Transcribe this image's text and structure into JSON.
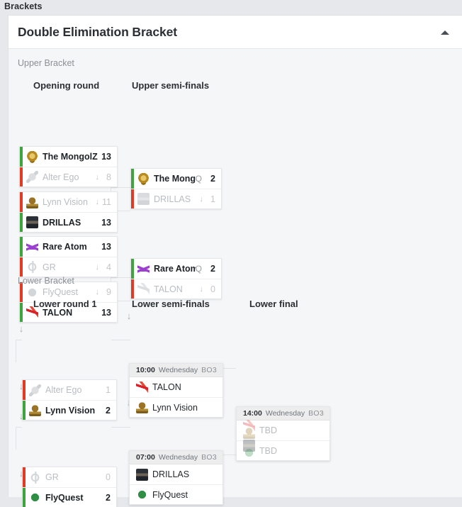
{
  "page": {
    "title": "Brackets"
  },
  "panel": {
    "heading": "Double Elimination Bracket",
    "collapse_icon": "chevron-up-icon"
  },
  "sections": {
    "upper": {
      "label": "Upper Bracket"
    },
    "lower": {
      "label": "Lower Bracket"
    }
  },
  "rounds": {
    "opening": "Opening round",
    "upper_semis": "Upper semi-finals",
    "lower_r1": "Lower round 1",
    "lower_semis": "Lower semi-finals",
    "lower_final": "Lower final"
  },
  "colors": {
    "winner_bar": "#3fa43f",
    "loser_bar": "#e03b24",
    "page_bg": "#e6e8eb",
    "body_bg": "#f5f6f7",
    "card_bg": "#ffffff"
  },
  "labels": {
    "down_arrow": "↓",
    "qualified": "Q",
    "tbd": "TBD",
    "drop_marker": "↓"
  },
  "upper_bracket": {
    "opening_round": [
      {
        "teams": [
          {
            "name": "The MongolZ",
            "score": "13",
            "result": "win",
            "logo": "mongolz-logo"
          },
          {
            "name": "Alter Ego",
            "score": "8",
            "result": "lose",
            "logo": "alter-ego-logo"
          }
        ]
      },
      {
        "teams": [
          {
            "name": "Lynn Vision",
            "score": "11",
            "result": "lose",
            "logo": "lynn-vision-logo"
          },
          {
            "name": "DRILLAS",
            "score": "13",
            "result": "win",
            "logo": "drillas-logo"
          }
        ]
      },
      {
        "teams": [
          {
            "name": "Rare Atom",
            "score": "13",
            "result": "win",
            "logo": "rare-atom-logo"
          },
          {
            "name": "GR",
            "score": "4",
            "result": "lose",
            "logo": "gr-logo"
          }
        ]
      },
      {
        "teams": [
          {
            "name": "FlyQuest",
            "score": "9",
            "result": "lose",
            "logo": "flyquest-logo"
          },
          {
            "name": "TALON",
            "score": "13",
            "result": "win",
            "logo": "talon-logo"
          }
        ]
      }
    ],
    "upper_semi_finals": [
      {
        "teams": [
          {
            "name": "The MongolZ",
            "score": "2",
            "result": "win",
            "qualified": "Q",
            "logo": "mongolz-logo"
          },
          {
            "name": "DRILLAS",
            "score": "1",
            "result": "lose",
            "logo": "drillas-logo"
          }
        ]
      },
      {
        "teams": [
          {
            "name": "Rare Atom",
            "score": "2",
            "result": "win",
            "qualified": "Q",
            "logo": "rare-atom-logo"
          },
          {
            "name": "TALON",
            "score": "0",
            "result": "lose",
            "logo": "talon-logo"
          }
        ]
      }
    ]
  },
  "lower_bracket": {
    "lower_round_1": [
      {
        "teams": [
          {
            "name": "Alter Ego",
            "score": "1",
            "result": "lose",
            "logo": "alter-ego-logo"
          },
          {
            "name": "Lynn Vision",
            "score": "2",
            "result": "win",
            "logo": "lynn-vision-logo"
          }
        ]
      },
      {
        "teams": [
          {
            "name": "GR",
            "score": "0",
            "result": "lose",
            "logo": "gr-logo"
          },
          {
            "name": "FlyQuest",
            "score": "2",
            "result": "win",
            "logo": "flyquest-logo"
          }
        ]
      }
    ],
    "lower_semi_finals": [
      {
        "time": "10:00",
        "day": "Wednesday",
        "format": "BO3",
        "teams": [
          {
            "name": "TALON",
            "logo": "talon-logo"
          },
          {
            "name": "Lynn Vision",
            "logo": "lynn-vision-logo"
          }
        ]
      },
      {
        "time": "07:00",
        "day": "Wednesday",
        "format": "BO3",
        "teams": [
          {
            "name": "DRILLAS",
            "logo": "drillas-logo"
          },
          {
            "name": "FlyQuest",
            "logo": "flyquest-logo"
          }
        ]
      }
    ],
    "lower_final": [
      {
        "time": "14:00",
        "day": "Wednesday",
        "format": "BO3",
        "teams": [
          {
            "name": "TBD",
            "logo": "talon-lynn-vision-placeholder-logo"
          },
          {
            "name": "TBD",
            "logo": "drillas-flyquest-placeholder-logo"
          }
        ]
      }
    ]
  }
}
